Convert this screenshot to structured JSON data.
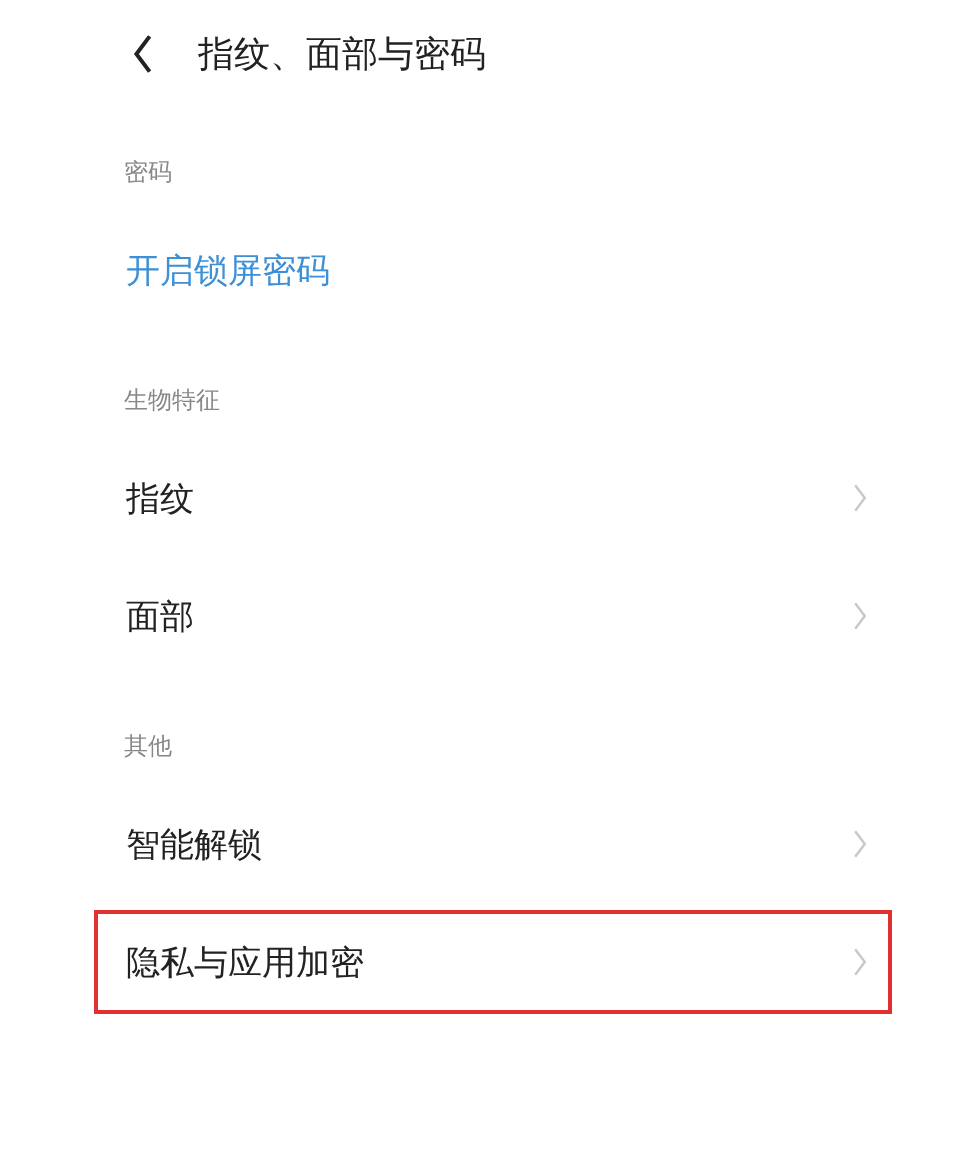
{
  "header": {
    "title": "指纹、面部与密码"
  },
  "sections": [
    {
      "title": "密码",
      "items": [
        {
          "label": "开启锁屏密码",
          "kind": "link",
          "highlighted": false
        }
      ]
    },
    {
      "title": "生物特征",
      "items": [
        {
          "label": "指纹",
          "kind": "nav",
          "highlighted": false
        },
        {
          "label": "面部",
          "kind": "nav",
          "highlighted": false
        }
      ]
    },
    {
      "title": "其他",
      "items": [
        {
          "label": "智能解锁",
          "kind": "nav",
          "highlighted": false
        },
        {
          "label": "隐私与应用加密",
          "kind": "nav",
          "highlighted": true
        }
      ]
    }
  ]
}
